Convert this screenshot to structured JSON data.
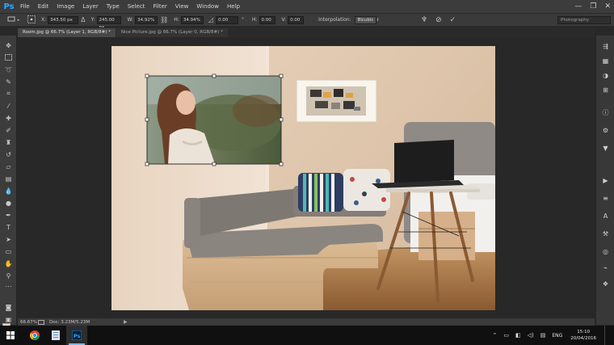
{
  "app": {
    "logo": "Ps"
  },
  "menu": [
    "File",
    "Edit",
    "Image",
    "Layer",
    "Type",
    "Select",
    "Filter",
    "View",
    "Window",
    "Help"
  ],
  "window_controls": {
    "minimize": "—",
    "restore": "❐",
    "close": "✕"
  },
  "options": {
    "x_label": "X:",
    "x_value": "343.50 px",
    "y_label": "Y:",
    "y_value": "245.00 px",
    "w_label": "W:",
    "w_value": "34.92%",
    "h_label": "H:",
    "h_value": "34.94%",
    "angle_value": "0.00",
    "angle_unit": "°",
    "hskew_label": "H:",
    "hskew_value": "0.00",
    "vskew_label": "V:",
    "vskew_value": "0.00",
    "interp_label": "Interpolation:",
    "interp_value": "Bicubic",
    "workspace": "Photography"
  },
  "tabs": [
    {
      "label": "Room.jpg @ 66.7% (Layer 1, RGB/8#) *"
    },
    {
      "label": "Nice Picture.jpg @ 66.7% (Layer 0, RGB/8#) *"
    }
  ],
  "status": {
    "zoom": "66.67%",
    "doc": "Doc: 3.23M/5.23M"
  },
  "taskbar": {
    "lang": "ENG",
    "time": "15:10",
    "date": "20/04/2016"
  },
  "colors": {
    "foreground": "#f3d2c1",
    "background": "#ffffff",
    "accent": "#31a8ff"
  }
}
